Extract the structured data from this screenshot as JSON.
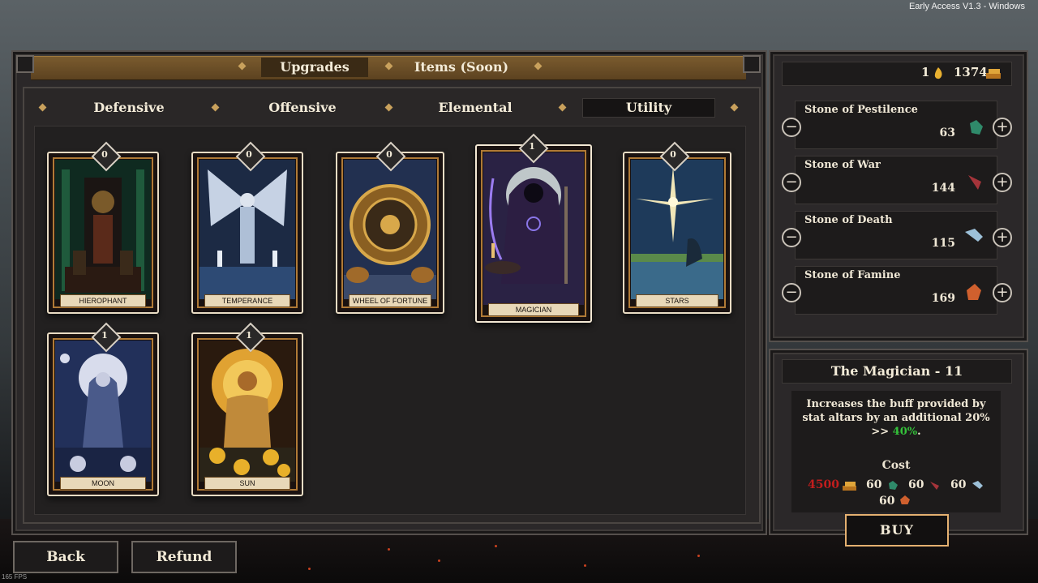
{
  "version": "Early Access V1.3 - Windows",
  "fps": "165 FPS",
  "top_tabs": [
    {
      "label": "Upgrades",
      "active": true
    },
    {
      "label": "Items (Soon)",
      "active": false
    }
  ],
  "sub_tabs": [
    {
      "label": "Defensive"
    },
    {
      "label": "Offensive"
    },
    {
      "label": "Elemental"
    },
    {
      "label": "Utility",
      "active": true
    }
  ],
  "cards": [
    {
      "name": "HIEROPHANT",
      "level": "0"
    },
    {
      "name": "TEMPERANCE",
      "level": "0"
    },
    {
      "name": "WHEEL OF FORTUNE",
      "level": "0"
    },
    {
      "name": "MAGICIAN",
      "level": "1",
      "selected": true
    },
    {
      "name": "STARS",
      "level": "0"
    },
    {
      "name": "MOON",
      "level": "1"
    },
    {
      "name": "SUN",
      "level": "1"
    }
  ],
  "currency": {
    "souls": "1",
    "gold": "1374"
  },
  "stones": [
    {
      "name": "Stone of Pestilence",
      "count": "63",
      "color": "#2f8a6a"
    },
    {
      "name": "Stone of War",
      "count": "144",
      "color": "#a5343a"
    },
    {
      "name": "Stone of Death",
      "count": "115",
      "color": "#9cc0d8"
    },
    {
      "name": "Stone of Famine",
      "count": "169",
      "color": "#d0602e"
    }
  ],
  "detail": {
    "title": "The Magician - 11",
    "description": "Increases the buff provided by stat altars by an additional 20%",
    "arrow": ">>",
    "next_value": "40%",
    "period": ".",
    "cost_label": "Cost",
    "cost_gold": "4500",
    "cost_pestilence": "60",
    "cost_war": "60",
    "cost_death": "60",
    "cost_famine": "60",
    "buy": "BUY"
  },
  "buttons": {
    "back": "Back",
    "refund": "Refund"
  },
  "colors": {
    "gold": "#d7a03a",
    "insufficient": "#c21d1d",
    "bonus": "#34c23a"
  }
}
